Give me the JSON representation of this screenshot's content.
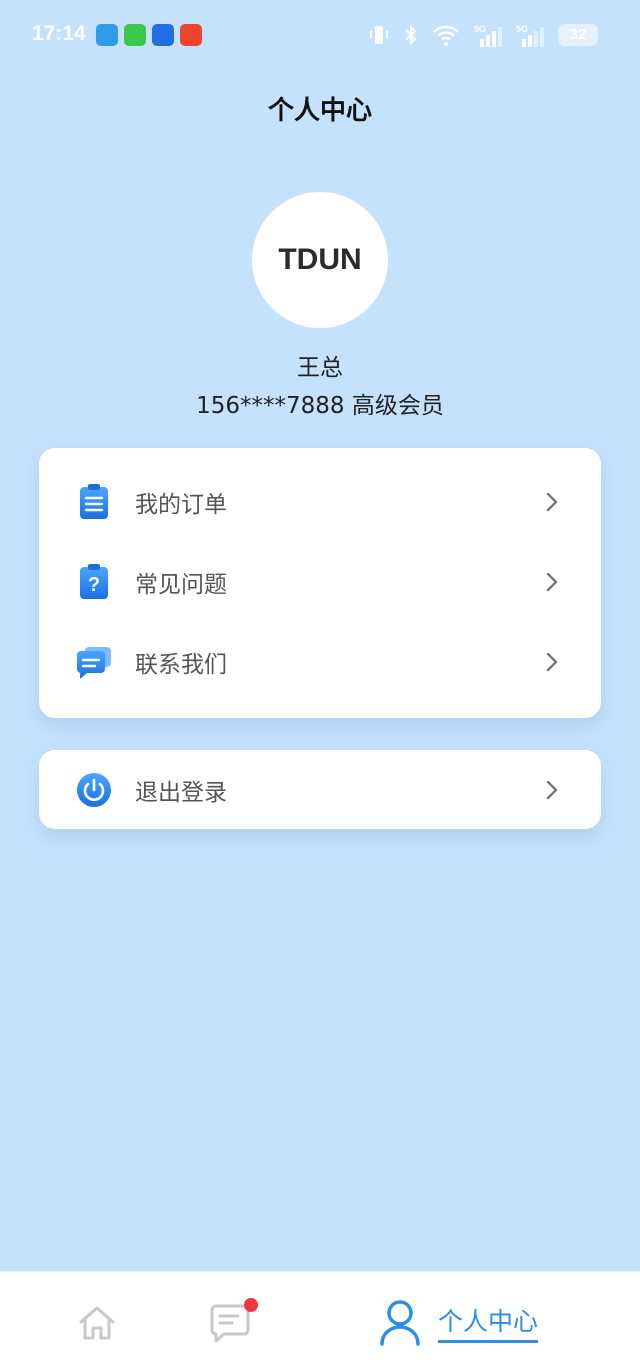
{
  "status_bar": {
    "time": "17:14",
    "battery": "32",
    "network_1": "5G",
    "network_2": "5G"
  },
  "header": {
    "title": "个人中心"
  },
  "profile": {
    "avatar_text": "TDUN",
    "name": "王总",
    "info": "156****7888 高级会员"
  },
  "menu": {
    "items": [
      {
        "label": "我的订单",
        "icon": "clipboard-list-icon"
      },
      {
        "label": "常见问题",
        "icon": "question-clipboard-icon"
      },
      {
        "label": "联系我们",
        "icon": "chat-bubbles-icon"
      }
    ],
    "logout": {
      "label": "退出登录",
      "icon": "power-icon"
    }
  },
  "bottom_nav": {
    "items": [
      {
        "icon": "home-icon",
        "label": ""
      },
      {
        "icon": "message-icon",
        "label": ""
      },
      {
        "icon": "user-icon",
        "label": "个人中心",
        "active": true
      }
    ]
  },
  "colors": {
    "background": "#c5e2fd",
    "accent": "#2a8de8",
    "badge": "#f2353b"
  }
}
